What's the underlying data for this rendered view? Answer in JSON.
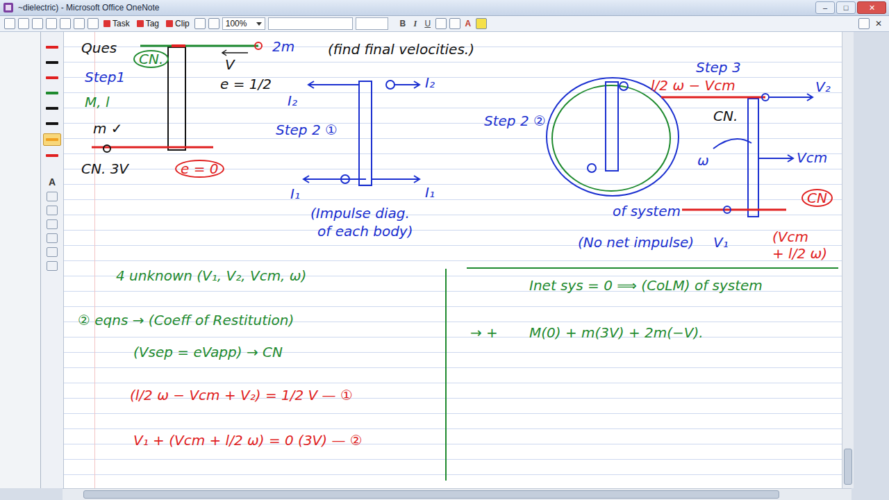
{
  "window": {
    "title": "~dielectric) - Microsoft Office OneNote",
    "controls": [
      "–",
      "□",
      "✕"
    ]
  },
  "toolbar": {
    "buttons": [
      {
        "label": "Task"
      },
      {
        "label": "Tag"
      },
      {
        "label": "Clip"
      }
    ],
    "zoom": "100%",
    "format": [
      "B",
      "I",
      "U"
    ],
    "font_color": "A",
    "close": "✕"
  },
  "pens": [
    {
      "color": "#e02020",
      "selected": false
    },
    {
      "color": "#111111",
      "selected": false
    },
    {
      "color": "#e02020",
      "selected": false
    },
    {
      "color": "#1e8a2e",
      "selected": false
    },
    {
      "color": "#111111",
      "selected": false
    },
    {
      "color": "#111111",
      "selected": false
    },
    {
      "color": "#f0a020",
      "selected": true
    },
    {
      "color": "#e02020",
      "selected": false
    }
  ],
  "text_tool": "A",
  "notes": [
    {
      "text": "Ques",
      "color": "#111111",
      "circled": false
    },
    {
      "text": "CN.",
      "color": "#1e8a2e",
      "circled": true
    },
    {
      "text": "Step1",
      "color": "#1a2fd0",
      "circled": false
    },
    {
      "text": "M, l",
      "color": "#1e8a2e",
      "circled": false
    },
    {
      "text": "2m",
      "color": "#1a2fd0",
      "circled": false
    },
    {
      "text": "V",
      "color": "#111111",
      "circled": false
    },
    {
      "text": "e = 1/2",
      "color": "#111111",
      "circled": false
    },
    {
      "text": "m ✓",
      "color": "#111111",
      "circled": false
    },
    {
      "text": "CN. 3V",
      "color": "#111111",
      "circled": false
    },
    {
      "text": "e = 0",
      "color": "#e02020",
      "circled": true
    },
    {
      "text": "(find final velocities.)",
      "color": "#111111",
      "circled": false
    },
    {
      "text": "I₂",
      "color": "#1a2fd0",
      "circled": false
    },
    {
      "text": "I₂",
      "color": "#1a2fd0",
      "circled": false
    },
    {
      "text": "Step 2 ①",
      "color": "#1a2fd0",
      "circled": false
    },
    {
      "text": "I₁",
      "color": "#1a2fd0",
      "circled": false
    },
    {
      "text": "I₁",
      "color": "#1a2fd0",
      "circled": false
    },
    {
      "text": "(Impulse diag.",
      "color": "#1a2fd0",
      "circled": false
    },
    {
      "text": "of each body)",
      "color": "#1a2fd0",
      "circled": false
    },
    {
      "text": "Step 2 ②",
      "color": "#1a2fd0",
      "circled": false
    },
    {
      "text": "Step 3",
      "color": "#1a2fd0",
      "circled": false
    },
    {
      "text": "l/2 ω − Vcm",
      "color": "#e02020",
      "circled": false
    },
    {
      "text": "CN.",
      "color": "#111111",
      "circled": false
    },
    {
      "text": "V₂",
      "color": "#1a2fd0",
      "circled": false
    },
    {
      "text": "ω",
      "color": "#1a2fd0",
      "circled": false
    },
    {
      "text": "Vcm",
      "color": "#1a2fd0",
      "circled": false
    },
    {
      "text": "CN",
      "color": "#e02020",
      "circled": true
    },
    {
      "text": "V₁",
      "color": "#1a2fd0",
      "circled": false
    },
    {
      "text": "(Vcm",
      "color": "#e02020",
      "circled": false
    },
    {
      "text": "+ l/2 ω)",
      "color": "#e02020",
      "circled": false
    },
    {
      "text": "of system",
      "color": "#1a2fd0",
      "circled": false
    },
    {
      "text": "(No net impulse)",
      "color": "#1a2fd0",
      "circled": false
    },
    {
      "text": "4 unknown (V₁, V₂, Vcm, ω)",
      "color": "#1e8a2e",
      "circled": false
    },
    {
      "text": "② eqns → (Coeff of Restitution)",
      "color": "#1e8a2e",
      "circled": false
    },
    {
      "text": "(Vsep = eVapp) → CN",
      "color": "#1e8a2e",
      "circled": false
    },
    {
      "text": "(l/2 ω − Vcm + V₂) = 1/2 V — ①",
      "color": "#e02020",
      "circled": false
    },
    {
      "text": "V₁ + (Vcm + l/2 ω) = 0 (3V) — ②",
      "color": "#e02020",
      "circled": false
    },
    {
      "text": "Inet sys = 0 ⟹ (CoLM) of system",
      "color": "#1e8a2e",
      "circled": false
    },
    {
      "text": "→ +",
      "color": "#1e8a2e",
      "circled": false
    },
    {
      "text": "M(0) + m(3V) + 2m(−V).",
      "color": "#1e8a2e",
      "circled": false
    }
  ]
}
